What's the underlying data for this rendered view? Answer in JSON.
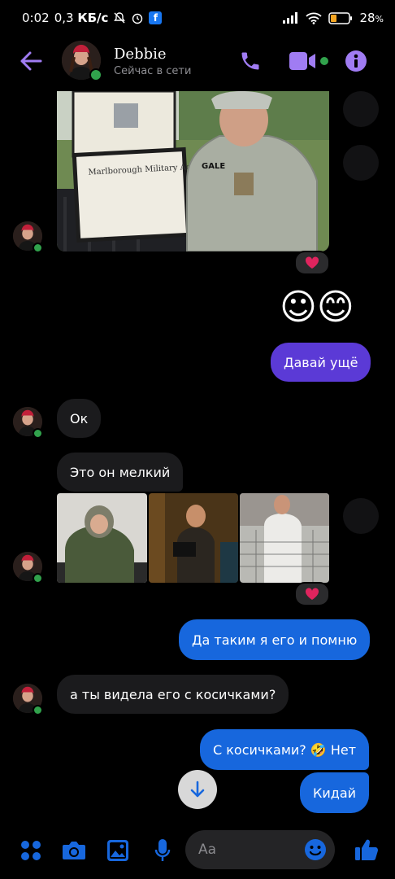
{
  "status_bar": {
    "time": "0:02",
    "speed_value": "0,3",
    "speed_unit": "КБ/с",
    "battery": "28"
  },
  "header": {
    "contact_name": "Debbie",
    "presence": "Сейчас в сети"
  },
  "messages": {
    "emoji_reply": "☺😊",
    "out_1": "Давай ущё",
    "in_1": "Ок",
    "in_2": "Это он мелкий",
    "out_2": "Да таким я его и помню",
    "in_3": "а ты видела его с косичками?",
    "out_3": "С косичками? 🤣 Нет",
    "out_4": "Кидай"
  },
  "composer": {
    "placeholder": "Aa"
  },
  "colors": {
    "accent": "#a07cf3",
    "outgoing": "#1767dd",
    "outgoing_purple": "#5b3ad6",
    "online": "#31a24c"
  }
}
